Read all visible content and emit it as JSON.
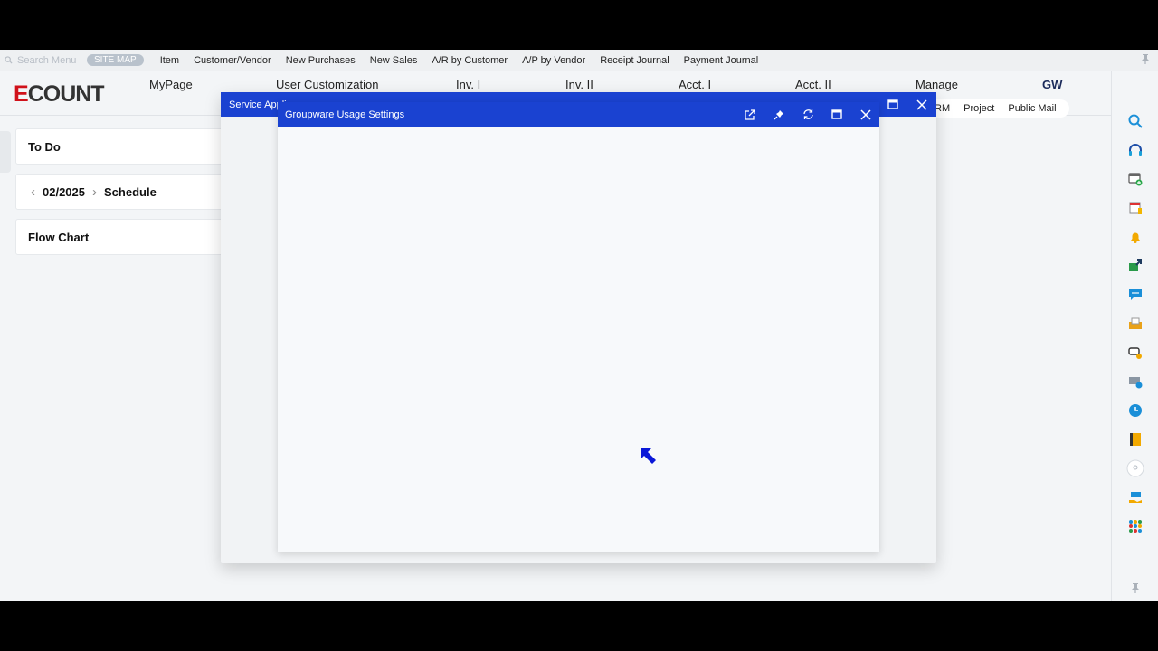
{
  "quickbar": {
    "search_placeholder": "Search Menu",
    "sitemap_label": "SITE MAP",
    "items": [
      "Item",
      "Customer/Vendor",
      "New Purchases",
      "New Sales",
      "A/R by Customer",
      "A/P by Vendor",
      "Receipt Journal",
      "Payment Journal"
    ]
  },
  "header": {
    "logo_e": "E",
    "logo_rest": "COUNT",
    "nav": [
      "MyPage",
      "User Customization",
      "Inv. I",
      "Inv. II",
      "Acct. I",
      "Acct. II",
      "Manage",
      "GW"
    ]
  },
  "widgets": {
    "todo": "To Do",
    "schedule_date": "02/2025",
    "schedule_label": "Schedule",
    "flowchart": "Flow Chart"
  },
  "subtabs": [
    "RM",
    "Project",
    "Public Mail"
  ],
  "outer_modal": {
    "title": "Service Appli"
  },
  "inner_modal": {
    "title": "Groupware Usage Settings"
  },
  "colors": {
    "titlebar": "#1a42d1",
    "logo_red": "#d0111a",
    "cursor": "#0a18d8"
  },
  "rail_icons": [
    "search-icon",
    "headset-icon",
    "add-window-icon",
    "document-icon",
    "bell-icon",
    "share-icon",
    "chat-icon",
    "inbox-icon",
    "card-icon",
    "payment-icon",
    "clock-icon",
    "book-icon",
    "profile-icon",
    "hand-money-icon",
    "apps-grid-icon"
  ]
}
